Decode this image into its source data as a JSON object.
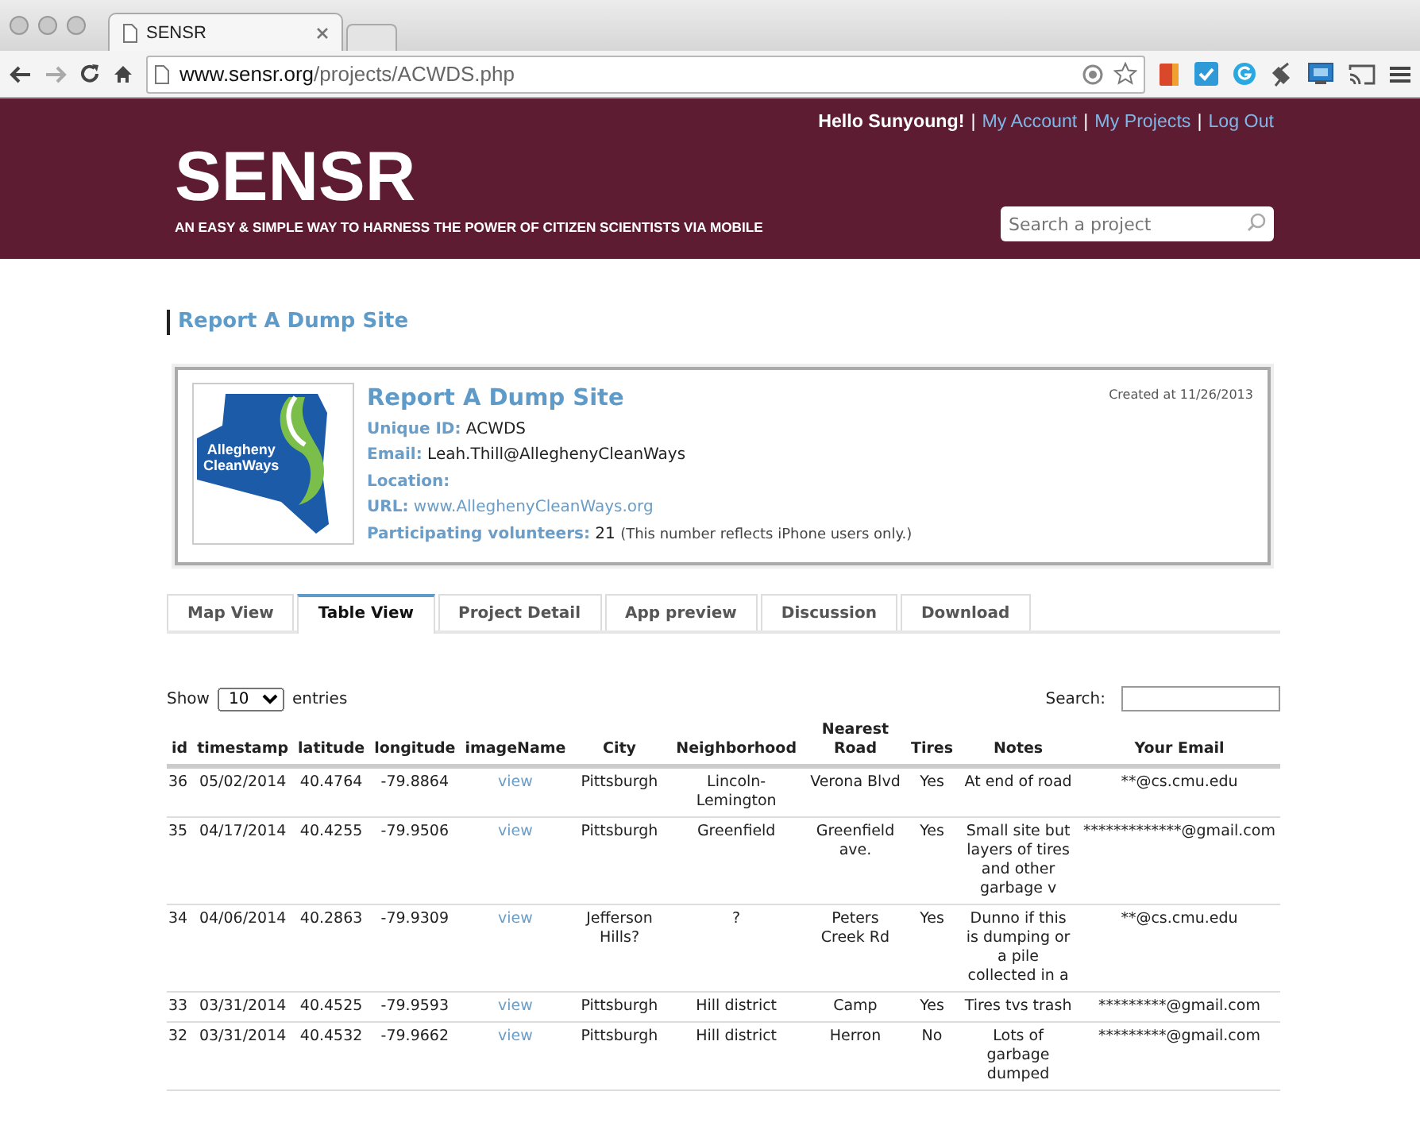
{
  "browser": {
    "tab_title": "SENSR",
    "url_host": "www.sensr.org",
    "url_path": "/projects/ACWDS.php"
  },
  "header": {
    "greeting": "Hello Sunyoung!",
    "separator": "|",
    "links": [
      "My Account",
      "My Projects",
      "Log Out"
    ],
    "logo": "SENSR",
    "tagline": "AN EASY & SIMPLE WAY TO HARNESS THE POWER OF CITIZEN SCIENTISTS VIA MOBILE",
    "search_placeholder": "Search a project"
  },
  "page_title": "Report A Dump Site",
  "project": {
    "logo_lines": [
      "Allegheny",
      "CleanWays"
    ],
    "title": "Report A Dump Site",
    "created": "Created at 11/26/2013",
    "fields": [
      {
        "label": "Unique ID:",
        "value": "ACWDS",
        "kind": "text"
      },
      {
        "label": "Email:",
        "value": "Leah.Thill@AlleghenyCleanWays",
        "kind": "text"
      },
      {
        "label": "Location:",
        "kind": "text"
      },
      {
        "label": "URL:",
        "value": "www.AlleghenyCleanWays.org",
        "kind": "link"
      },
      {
        "label": "Participating volunteers:",
        "value": "21",
        "note": "(This number reflects iPhone users only.)",
        "kind": "text"
      }
    ]
  },
  "tabs": [
    {
      "label": "Map View",
      "selected": false
    },
    {
      "label": "Table View",
      "selected": true
    },
    {
      "label": "Project Detail",
      "selected": false
    },
    {
      "label": "App preview",
      "selected": false
    },
    {
      "label": "Discussion",
      "selected": false
    },
    {
      "label": "Download",
      "selected": false
    }
  ],
  "table": {
    "show_label": "Show",
    "page_size": "10",
    "entries_label": "entries",
    "search_label": "Search:",
    "columns": [
      {
        "label": "id",
        "kind": "text"
      },
      {
        "label": "timestamp",
        "kind": "text"
      },
      {
        "label": "latitude",
        "kind": "text"
      },
      {
        "label": "longitude",
        "kind": "text"
      },
      {
        "label": "imageName",
        "kind": "link"
      },
      {
        "label": "City",
        "kind": "text"
      },
      {
        "label": "Neighborhood",
        "kind": "text"
      },
      {
        "label": "Nearest Road",
        "kind": "text"
      },
      {
        "label": "Tires",
        "kind": "text"
      },
      {
        "label": "Notes",
        "kind": "text"
      },
      {
        "label": "Your Email",
        "kind": "text"
      }
    ],
    "rows": [
      [
        "36",
        "05/02/2014",
        "40.4764",
        "-79.8864",
        "view",
        "Pittsburgh",
        "Lincoln-Lemington",
        "Verona Blvd",
        "Yes",
        "At end of road",
        "**@cs.cmu.edu"
      ],
      [
        "35",
        "04/17/2014",
        "40.4255",
        "-79.9506",
        "view",
        "Pittsburgh",
        "Greenfield",
        "Greenfield ave.",
        "Yes",
        "Small site but layers of tires and other garbage v",
        "*************@gmail.com"
      ],
      [
        "34",
        "04/06/2014",
        "40.2863",
        "-79.9309",
        "view",
        "Jefferson Hills?",
        "?",
        "Peters Creek Rd",
        "Yes",
        "Dunno if this is dumping or a pile collected in a",
        "**@cs.cmu.edu"
      ],
      [
        "33",
        "03/31/2014",
        "40.4525",
        "-79.9593",
        "view",
        "Pittsburgh",
        "Hill district",
        "Camp",
        "Yes",
        "Tires tvs trash",
        "*********@gmail.com"
      ],
      [
        "32",
        "03/31/2014",
        "40.4532",
        "-79.9662",
        "view",
        "Pittsburgh",
        "Hill district",
        "Herron",
        "No",
        "Lots of garbage dumped",
        "*********@gmail.com"
      ]
    ]
  }
}
